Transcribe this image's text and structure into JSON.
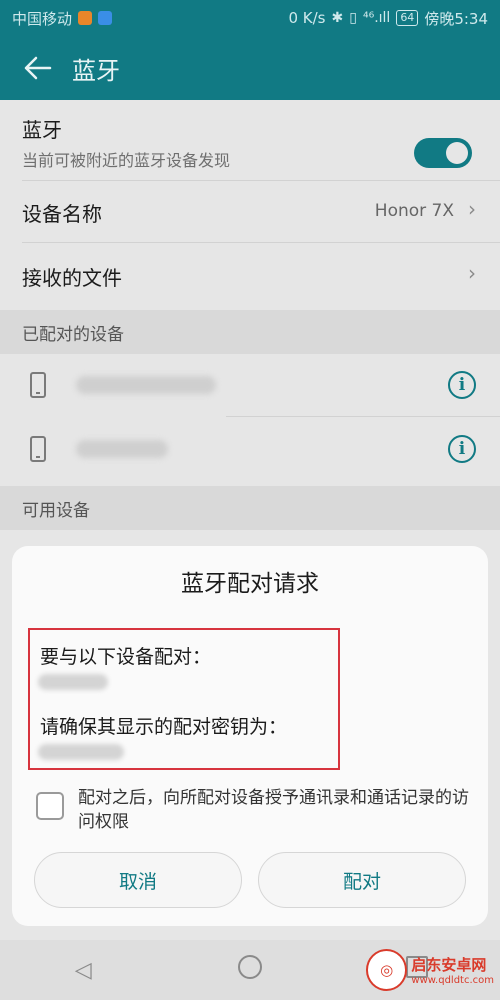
{
  "status_bar": {
    "carrier": "中国移动",
    "speed": "0 K/s",
    "network": "⁴⁶.ıll",
    "battery": "64",
    "time": "傍晚5:34"
  },
  "app_bar": {
    "title": "蓝牙"
  },
  "bluetooth_row": {
    "title": "蓝牙",
    "subtitle": "当前可被附近的蓝牙设备发现",
    "enabled": true
  },
  "device_name_row": {
    "title": "设备名称",
    "value": "Honor 7X"
  },
  "received_files_row": {
    "title": "接收的文件"
  },
  "paired_section": {
    "header": "已配对的设备"
  },
  "available_section": {
    "header": "可用设备"
  },
  "dialog": {
    "title": "蓝牙配对请求",
    "pair_with_label": "要与以下设备配对：",
    "confirm_key_label": "请确保其显示的配对密钥为：",
    "checkbox_label": "配对之后，向所配对设备授予通讯录和通话记录的访问权限",
    "cancel_label": "取消",
    "pair_label": "配对"
  },
  "watermark": {
    "name": "启东安卓网",
    "url": "www.qdldtc.com"
  },
  "colors": {
    "accent": "#117a84",
    "highlight_border": "#d7343e"
  }
}
